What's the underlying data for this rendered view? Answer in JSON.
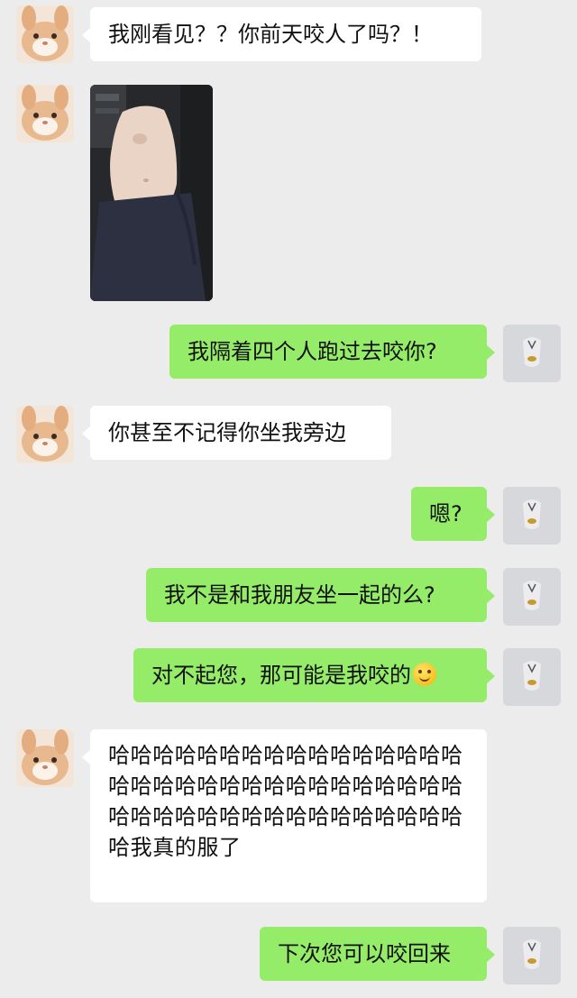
{
  "messages": [
    {
      "side": "left",
      "type": "text",
      "text": "我刚看见？？你前天咬人了吗？！"
    },
    {
      "side": "left",
      "type": "image",
      "icon": "photo-of-leg-in-car"
    },
    {
      "side": "right",
      "type": "text",
      "text": "我隔着四个人跑过去咬你?"
    },
    {
      "side": "left",
      "type": "text",
      "text": "你甚至不记得你坐我旁边"
    },
    {
      "side": "right",
      "type": "text",
      "text": "嗯?"
    },
    {
      "side": "right",
      "type": "text",
      "text": "我不是和我朋友坐一起的么?"
    },
    {
      "side": "right",
      "type": "text",
      "text": "对不起您，那可能是我咬的",
      "emoji": "smile-emoji"
    },
    {
      "side": "left",
      "type": "text",
      "text": "哈哈哈哈哈哈哈哈哈哈哈哈哈哈哈哈哈哈哈哈哈哈哈哈哈哈哈哈哈哈哈哈哈哈哈哈哈哈哈哈哈哈哈哈哈哈哈哈哈我真的服了"
    },
    {
      "side": "right",
      "type": "text",
      "text": "下次您可以咬回来"
    }
  ],
  "avatars": {
    "left": "rabbit-avatar-icon",
    "right": "bag-avatar-icon"
  },
  "colors": {
    "background": "#ececec",
    "bubble_sent": "#95ec69",
    "bubble_received": "#ffffff"
  }
}
